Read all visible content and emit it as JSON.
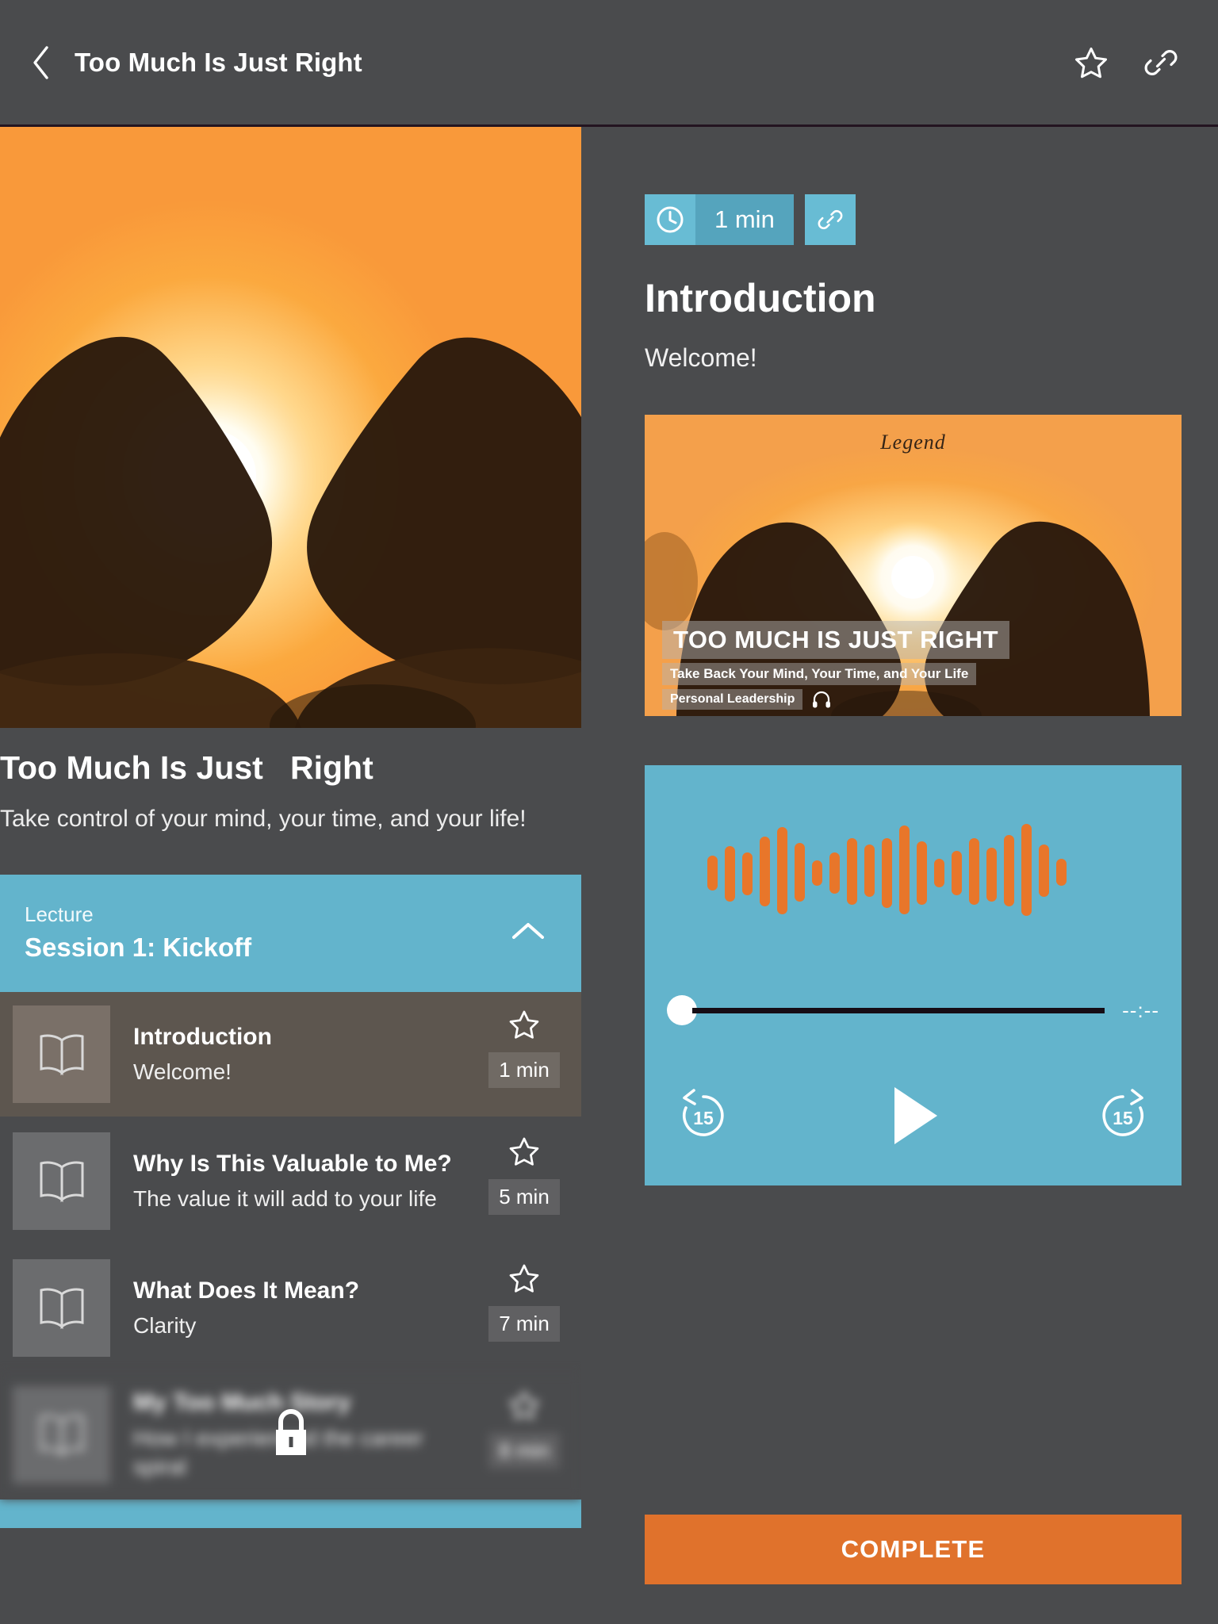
{
  "header": {
    "title": "Too Much Is Just Right",
    "back_icon": "chevron-left-icon",
    "favorite_icon": "star-icon",
    "share_icon": "link-icon"
  },
  "course": {
    "title": "Too Much Is Just   Right",
    "subtitle": "Take control of your mind, your time, and your life!",
    "hero_alt": "hands-forming-heart-at-sunset"
  },
  "section": {
    "kicker": "Lecture",
    "name": "Session 1: Kickoff",
    "collapse_icon": "chevron-up-icon"
  },
  "lessons": [
    {
      "title": "Introduction",
      "desc": "Welcome!",
      "duration": "1 min",
      "icon": "book-icon",
      "star": "star-icon",
      "active": true,
      "locked": false
    },
    {
      "title": "Why Is This Valuable to Me?",
      "desc": "The value it will add to your life",
      "duration": "5 min",
      "icon": "book-icon",
      "star": "star-icon",
      "active": false,
      "locked": false
    },
    {
      "title": "What Does It Mean?",
      "desc": "Clarity",
      "duration": "7 min",
      "icon": "book-icon",
      "star": "star-icon",
      "active": false,
      "locked": false
    },
    {
      "title": "My Too Much Story",
      "desc": "How I experienced the career spiral",
      "duration": "8 min",
      "icon": "book-icon",
      "star": "star-icon",
      "active": false,
      "locked": true,
      "lock_icon": "lock-icon"
    }
  ],
  "detail": {
    "duration": "1 min",
    "clock_icon": "clock-icon",
    "link_icon": "link-icon",
    "heading": "Introduction",
    "welcome": "Welcome!"
  },
  "thumbnail": {
    "logo": "Legend",
    "title": "TOO MUCH IS JUST RIGHT",
    "subtitle": "Take Back Your Mind, Your Time, and Your Life",
    "category": "Personal Leadership",
    "audio_icon": "headphones-icon"
  },
  "player": {
    "waveform_icon": "audio-waveform-icon",
    "elapsed_time": "--:--",
    "rewind_label": "15",
    "forward_label": "15",
    "rewind_icon": "replay-15-icon",
    "play_icon": "play-icon",
    "forward_icon": "forward-15-icon",
    "progress_percent": 0
  },
  "actions": {
    "complete_label": "COMPLETE"
  },
  "colors": {
    "background": "#4a4b4d",
    "accent_blue": "#63b4cc",
    "accent_blue_dark": "#55a4bd",
    "accent_orange": "#e0722c",
    "waveform_orange": "#e8762a",
    "active_row": "#5d564f"
  }
}
